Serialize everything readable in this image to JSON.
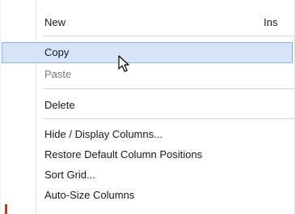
{
  "context_menu": {
    "items": [
      {
        "label": "New",
        "shortcut": "Ins",
        "state": "normal"
      },
      {
        "label": "Copy",
        "shortcut": "",
        "state": "highlighted"
      },
      {
        "label": "Paste",
        "shortcut": "",
        "state": "disabled"
      },
      {
        "label": "Delete",
        "shortcut": "",
        "state": "normal"
      },
      {
        "label": "Hide / Display Columns...",
        "shortcut": "",
        "state": "normal"
      },
      {
        "label": "Restore Default Column Positions",
        "shortcut": "",
        "state": "normal"
      },
      {
        "label": "Sort Grid...",
        "shortcut": "",
        "state": "normal"
      },
      {
        "label": "Auto-Size Columns",
        "shortcut": "",
        "state": "normal"
      }
    ]
  },
  "pointer": {
    "icon": "arrow-cursor-icon"
  },
  "colors": {
    "highlight_bg": "#d5e4f6",
    "highlight_border": "#8fb3e4",
    "disabled_text": "#7a7a7a"
  }
}
